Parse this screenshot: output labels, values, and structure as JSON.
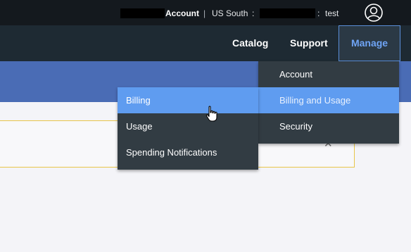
{
  "topbar": {
    "account_label": "Account",
    "separator": "|",
    "region": "US South",
    "colon1": ":",
    "colon2": ":",
    "space": "test"
  },
  "nav": {
    "catalog": "Catalog",
    "support": "Support",
    "manage": "Manage"
  },
  "manage_menu": [
    {
      "label": "Account"
    },
    {
      "label": "Billing and Usage"
    },
    {
      "label": "Security"
    }
  ],
  "billing_submenu": [
    {
      "label": "Billing"
    },
    {
      "label": "Usage"
    },
    {
      "label": "Spending Notifications"
    }
  ],
  "notice": {
    "close_symbol": "✕"
  },
  "colors": {
    "topbar": "#14191e",
    "navbar": "#1e2a33",
    "banner": "#4a6cb5",
    "menu": "#323c43",
    "highlight": "#5f9cf0",
    "manage_accent": "#6fa4f5",
    "notice_border": "#e8c549"
  },
  "icons": [
    "avatar-icon",
    "close-icon",
    "hand-cursor-icon"
  ]
}
